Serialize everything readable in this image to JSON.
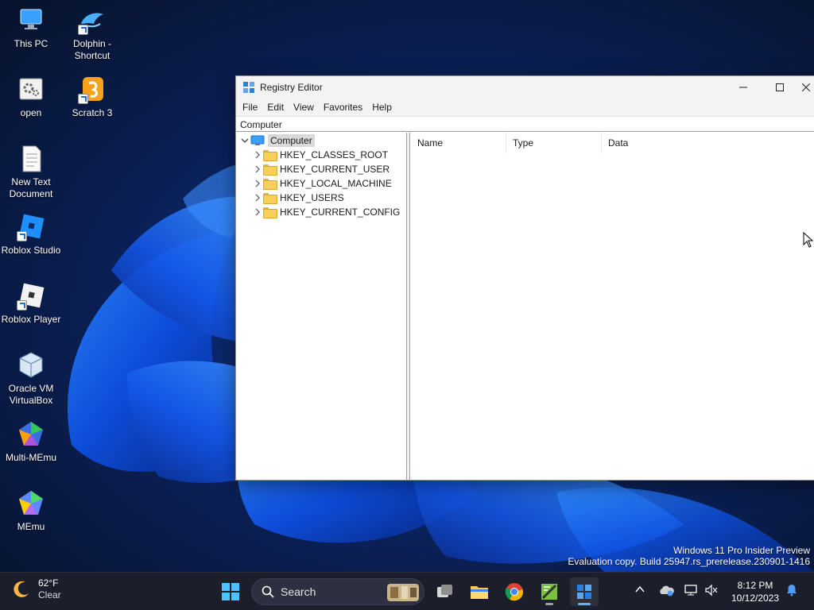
{
  "desktop": {
    "icons": [
      {
        "label": "This PC",
        "icon": "this-pc-icon"
      },
      {
        "label": "Dolphin - Shortcut",
        "icon": "dolphin-icon"
      },
      {
        "label": "open",
        "icon": "settings-file-icon"
      },
      {
        "label": "Scratch 3",
        "icon": "scratch-icon"
      },
      {
        "label": "New Text Document",
        "icon": "text-document-icon"
      },
      {
        "label": "Roblox Studio",
        "icon": "roblox-studio-icon"
      },
      {
        "label": "Roblox Player",
        "icon": "roblox-player-icon"
      },
      {
        "label": "Oracle VM VirtualBox",
        "icon": "virtualbox-icon"
      },
      {
        "label": "Multi-MEmu",
        "icon": "multi-memu-icon"
      },
      {
        "label": "MEmu",
        "icon": "memu-icon"
      }
    ],
    "watermark": {
      "line1": "Windows 11 Pro Insider Preview",
      "line2": "Evaluation copy. Build 25947.rs_prerelease.230901-1416"
    }
  },
  "regedit": {
    "title": "Registry Editor",
    "controls": {
      "minimize": "minimize-icon",
      "maximize": "maximize-icon",
      "close": "close-icon"
    },
    "menu": [
      "File",
      "Edit",
      "View",
      "Favorites",
      "Help"
    ],
    "address": "Computer",
    "tree": {
      "root": "Computer",
      "keys": [
        "HKEY_CLASSES_ROOT",
        "HKEY_CURRENT_USER",
        "HKEY_LOCAL_MACHINE",
        "HKEY_USERS",
        "HKEY_CURRENT_CONFIG"
      ]
    },
    "columns": [
      "Name",
      "Type",
      "Data"
    ]
  },
  "taskbar": {
    "weather": {
      "temp": "62°F",
      "condition": "Clear",
      "icon": "moon-icon"
    },
    "search_placeholder": "Search",
    "apps": [
      "start-icon",
      "task-view-icon",
      "file-explorer-icon",
      "chrome-icon",
      "notepad-plus-icon",
      "registry-editor-icon"
    ],
    "tray": [
      "chevron-up-icon",
      "onedrive-icon",
      "network-icon",
      "volume-muted-icon",
      "notification-bell-icon"
    ],
    "clock": {
      "time": "8:12 PM",
      "date": "10/12/2023"
    }
  },
  "colors": {
    "taskbar": "#1c1f2b",
    "accent": "#0078d4",
    "folder": "#f7cf5a"
  }
}
